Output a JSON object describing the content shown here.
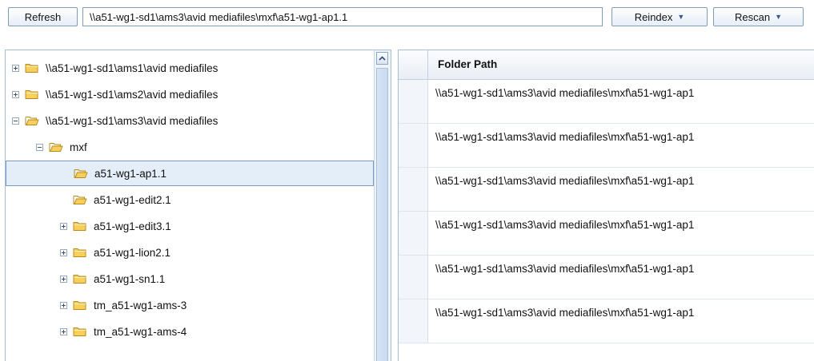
{
  "toolbar": {
    "refresh_label": "Refresh",
    "path_value": "\\\\a51-wg1-sd1\\ams3\\avid mediafiles\\mxf\\a51-wg1-ap1.1",
    "reindex_label": "Reindex",
    "rescan_label": "Rescan"
  },
  "tree": {
    "items": [
      {
        "label": "\\\\a51-wg1-sd1\\ams1\\avid mediafiles",
        "level": 0,
        "expander": "plus",
        "open": false,
        "selected": false
      },
      {
        "label": "\\\\a51-wg1-sd1\\ams2\\avid mediafiles",
        "level": 0,
        "expander": "plus",
        "open": false,
        "selected": false
      },
      {
        "label": "\\\\a51-wg1-sd1\\ams3\\avid mediafiles",
        "level": 0,
        "expander": "minus",
        "open": true,
        "selected": false
      },
      {
        "label": "mxf",
        "level": 1,
        "expander": "minus",
        "open": true,
        "selected": false
      },
      {
        "label": "a51-wg1-ap1.1",
        "level": 2,
        "expander": "none",
        "open": true,
        "selected": true
      },
      {
        "label": "a51-wg1-edit2.1",
        "level": 2,
        "expander": "none",
        "open": true,
        "selected": false
      },
      {
        "label": "a51-wg1-edit3.1",
        "level": 2,
        "expander": "plus",
        "open": false,
        "selected": false
      },
      {
        "label": "a51-wg1-lion2.1",
        "level": 2,
        "expander": "plus",
        "open": false,
        "selected": false
      },
      {
        "label": "a51-wg1-sn1.1",
        "level": 2,
        "expander": "plus",
        "open": false,
        "selected": false
      },
      {
        "label": "tm_a51-wg1-ams-3",
        "level": 2,
        "expander": "plus",
        "open": false,
        "selected": false
      },
      {
        "label": "tm_a51-wg1-ams-4",
        "level": 2,
        "expander": "plus",
        "open": false,
        "selected": false
      }
    ]
  },
  "grid": {
    "column_header": "Folder Path",
    "rows": [
      "\\\\a51-wg1-sd1\\ams3\\avid mediafiles\\mxf\\a51-wg1-ap1",
      "\\\\a51-wg1-sd1\\ams3\\avid mediafiles\\mxf\\a51-wg1-ap1",
      "\\\\a51-wg1-sd1\\ams3\\avid mediafiles\\mxf\\a51-wg1-ap1",
      "\\\\a51-wg1-sd1\\ams3\\avid mediafiles\\mxf\\a51-wg1-ap1",
      "\\\\a51-wg1-sd1\\ams3\\avid mediafiles\\mxf\\a51-wg1-ap1",
      "\\\\a51-wg1-sd1\\ams3\\avid mediafiles\\mxf\\a51-wg1-ap1"
    ]
  },
  "colors": {
    "folder_fill": "#f7cf5a",
    "folder_stroke": "#b98b1d",
    "selection_bg": "#e4eef9",
    "border": "#7f9db9"
  }
}
